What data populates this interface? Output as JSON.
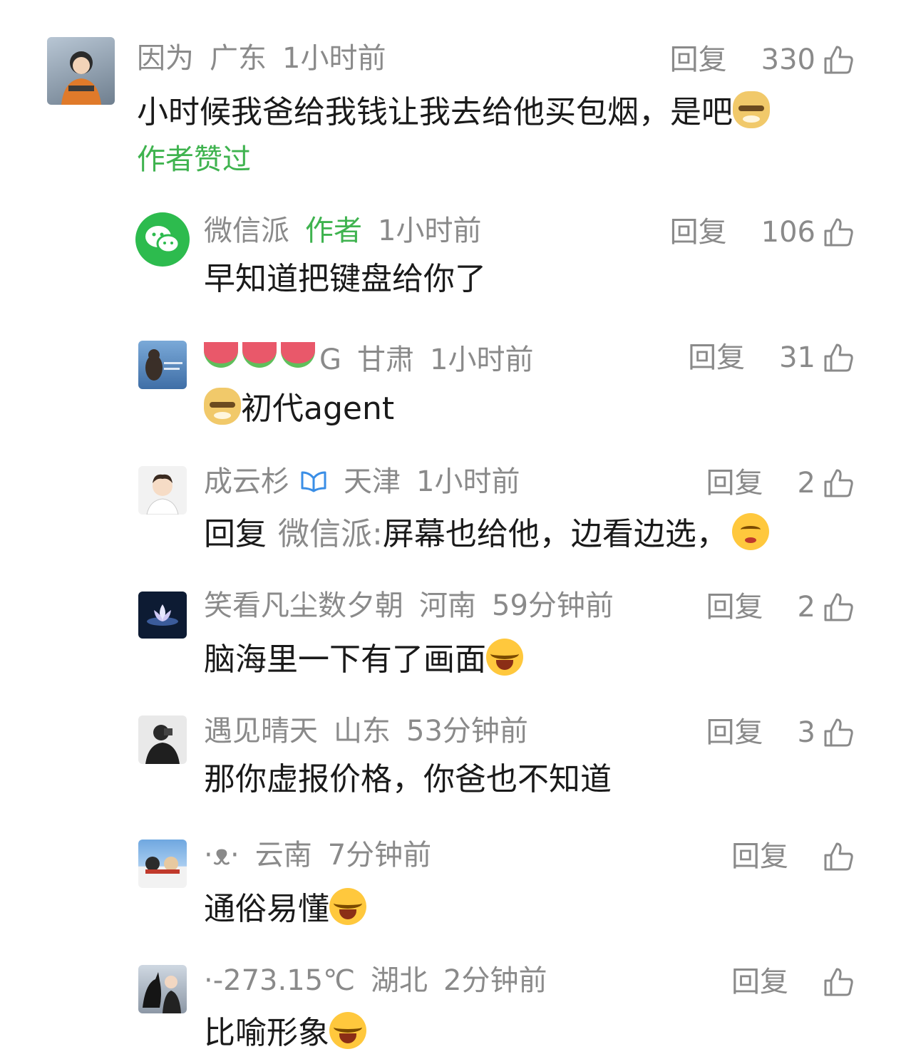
{
  "reply_label": "回复",
  "liked_by_author_label": "作者赞过",
  "icons": {
    "like": "thumbs-up-icon",
    "verified": "verified-badge-icon"
  },
  "colors": {
    "green": "#3fb34f",
    "gray": "#8a8a8a",
    "text": "#1a1a1a"
  },
  "comments": [
    {
      "name": "因为",
      "location": "广东",
      "time": "1小时前",
      "likes": "330",
      "text": "小时候我爸给我钱让我去给他买包烟，是吧",
      "emoji": "dog-smirk-emoji"
    },
    {
      "name": "微信派",
      "tag": "作者",
      "time": "1小时前",
      "likes": "106",
      "text": "早知道把键盘给你了"
    },
    {
      "name_suffix": "G",
      "location": "甘肃",
      "time": "1小时前",
      "likes": "31",
      "text": "初代agent",
      "emoji": "dog-smirk-emoji",
      "name_emoji": "watermelon-emoji"
    },
    {
      "name": "成云杉",
      "location": "天津",
      "time": "1小时前",
      "likes": "2",
      "reply_to": "微信派:",
      "text": "屏幕也给他，边看边选，",
      "emoji": "kissing-face-emoji"
    },
    {
      "name": "笑看凡尘数夕朝",
      "location": "河南",
      "time": "59分钟前",
      "likes": "2",
      "text": "脑海里一下有了画面",
      "emoji": "crying-laugh-emoji"
    },
    {
      "name": "遇见晴天",
      "location": "山东",
      "time": "53分钟前",
      "likes": "3",
      "text": "那你虚报价格，你爸也不知道"
    },
    {
      "name": "·ᴥ·",
      "location": "云南",
      "time": "7分钟前",
      "likes": "",
      "text": "通俗易懂",
      "emoji": "tears-of-joy-emoji"
    },
    {
      "name": "·-273.15℃",
      "location": "湖北",
      "time": "2分钟前",
      "likes": "",
      "text": "比喻形象",
      "emoji": "crying-laugh-emoji"
    }
  ]
}
